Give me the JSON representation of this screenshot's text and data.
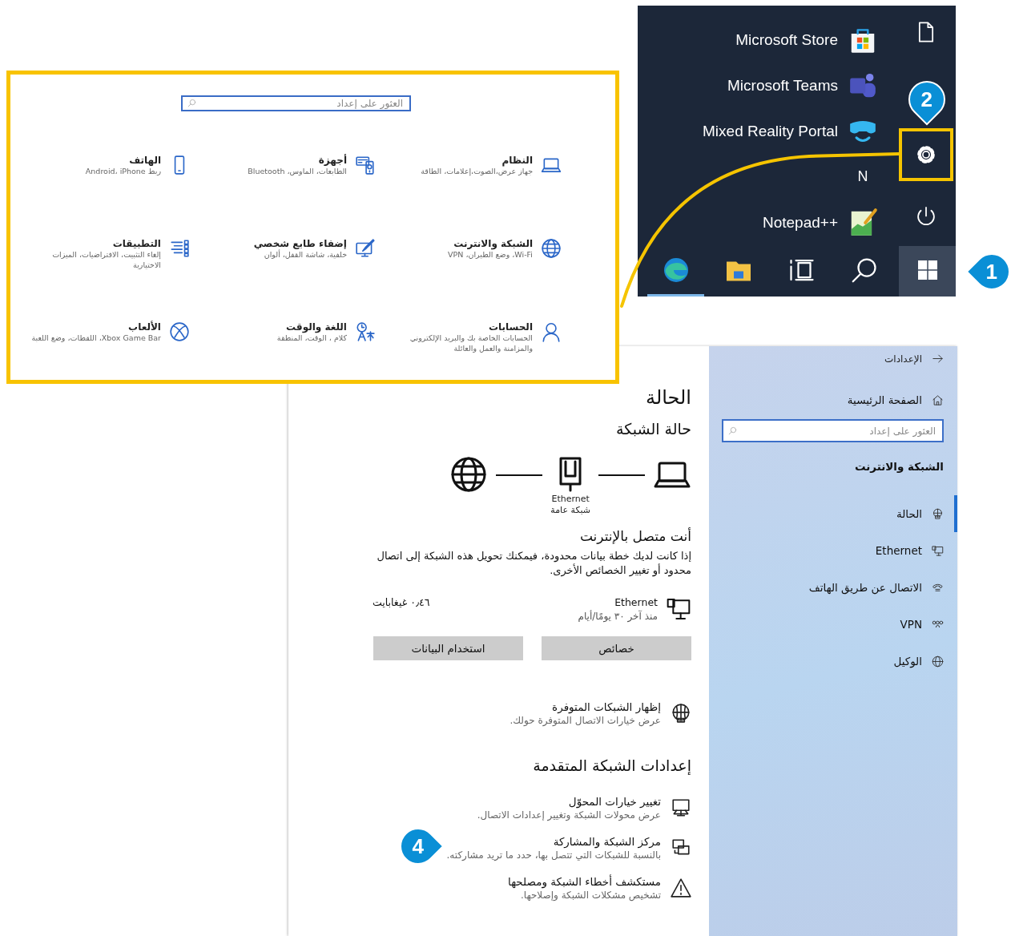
{
  "start_menu": {
    "apps": [
      {
        "kind": "store",
        "name": "Microsoft Store"
      },
      {
        "kind": "teams",
        "name": "Microsoft Teams"
      },
      {
        "kind": "mixed-reality",
        "name": "Mixed Reality Portal"
      },
      {
        "kind": "letter",
        "name": "N"
      },
      {
        "kind": "notepad",
        "name": "Notepad++"
      }
    ],
    "side_buttons": [
      {
        "kind": "document",
        "highlighted": false
      },
      {
        "kind": "settings",
        "highlighted": true,
        "callout": {
          "number": "2",
          "kind": "down"
        }
      },
      {
        "kind": "power",
        "highlighted": false
      }
    ],
    "taskbar": [
      {
        "kind": "edge",
        "running": true,
        "selected": false
      },
      {
        "kind": "explorer",
        "running": false,
        "selected": false
      },
      {
        "kind": "task-view",
        "running": false,
        "selected": false
      },
      {
        "kind": "search",
        "running": false,
        "selected": false
      },
      {
        "kind": "start",
        "running": false,
        "selected": true,
        "callout": {
          "number": "1",
          "kind": "left"
        }
      }
    ]
  },
  "settings_home": {
    "search": {
      "placeholder": "العثور على إعداد"
    },
    "tiles": [
      {
        "kind": "laptop",
        "title": "النظام",
        "description": "جهاز عرض،الصوت،إعلامات، الطاقة"
      },
      {
        "kind": "devices",
        "title": "أجهزة",
        "description": "الطابعات، الماوس، Bluetooth"
      },
      {
        "kind": "phone",
        "title": "الهاتف",
        "description": "ربط Android، iPhone"
      },
      {
        "kind": "globe",
        "title": "الشبكة والانترنت",
        "description": "Wi-Fi، وضع الطيران، VPN"
      },
      {
        "kind": "brush",
        "title": "إضفاء طابع شخصي",
        "description": "خلفية، شاشة القفل، ألوان"
      },
      {
        "kind": "apps",
        "title": "التطبيقات",
        "description": "إلغاء التثبيت، الافتراضيات، الميزات الاختيارية"
      },
      {
        "kind": "person",
        "title": "الحسابات",
        "description": "الحسابات الخاصة بك والبريد الإلكتروني والمزامنة والعمل والعائلة"
      },
      {
        "kind": "language",
        "title": "اللغة والوقت",
        "description": "كلام ، الوقت، المنطقة"
      },
      {
        "kind": "xbox",
        "title": "الألعاب",
        "description": "Xbox Game Bar، اللقطات، وضع اللعبة"
      }
    ]
  },
  "network_window": {
    "sidebar": {
      "back_label": "الإعدادات",
      "home_label": "الصفحة الرئيسية",
      "search": {
        "placeholder": "العثور على إعداد"
      },
      "section": "الشبكة والانترنت",
      "items": [
        {
          "kind": "status",
          "label": "الحالة",
          "selected": true
        },
        {
          "kind": "ethernet",
          "label": "Ethernet",
          "selected": false
        },
        {
          "kind": "dialup",
          "label": "الاتصال عن طريق الهاتف",
          "selected": false
        },
        {
          "kind": "vpn",
          "label": "VPN",
          "selected": false
        },
        {
          "kind": "proxy",
          "label": "الوكيل",
          "selected": false
        }
      ]
    },
    "main": {
      "title": "الحالة",
      "subtitle": "حالة الشبكة",
      "diagram": {
        "adapter": "Ethernet",
        "network_type": "شبكة عامة"
      },
      "connection_status": "أنت متصل بالإنترنت",
      "description": "إذا كانت لديك خطة بيانات محدودة، فيمكنك تحويل هذه الشبكة إلى اتصال محدود أو تغيير الخصائص الأخرى.",
      "adapter": {
        "name": "Ethernet",
        "period": "منذ آخر ٣٠ يومًا/أيام",
        "usage": "٠٫٤٦ غيغابايت"
      },
      "buttons": [
        "خصائص",
        "استخدام البيانات"
      ],
      "links": [
        {
          "kind": "available",
          "title": "إظهار الشبكات المتوفرة",
          "description": "عرض خيارات الاتصال المتوفرة حولك."
        }
      ],
      "advanced_heading": "إعدادات الشبكة المتقدمة",
      "advanced": [
        {
          "kind": "adapter",
          "title": "تغيير خيارات المحوّل",
          "description": "عرض محولات الشبكة وتغيير إعدادات الاتصال."
        },
        {
          "kind": "sharing",
          "title": "مركز الشبكة والمشاركة",
          "description": "بالنسبة للشبكات التي تتصل بها، حدد ما تريد مشاركته.",
          "callout": {
            "number": "4",
            "kind": "right"
          }
        },
        {
          "kind": "warning",
          "title": "مستكشف أخطاء الشبكة ومصلحها",
          "description": "تشخيص مشكلات الشبكة وإصلاحها."
        }
      ]
    }
  }
}
